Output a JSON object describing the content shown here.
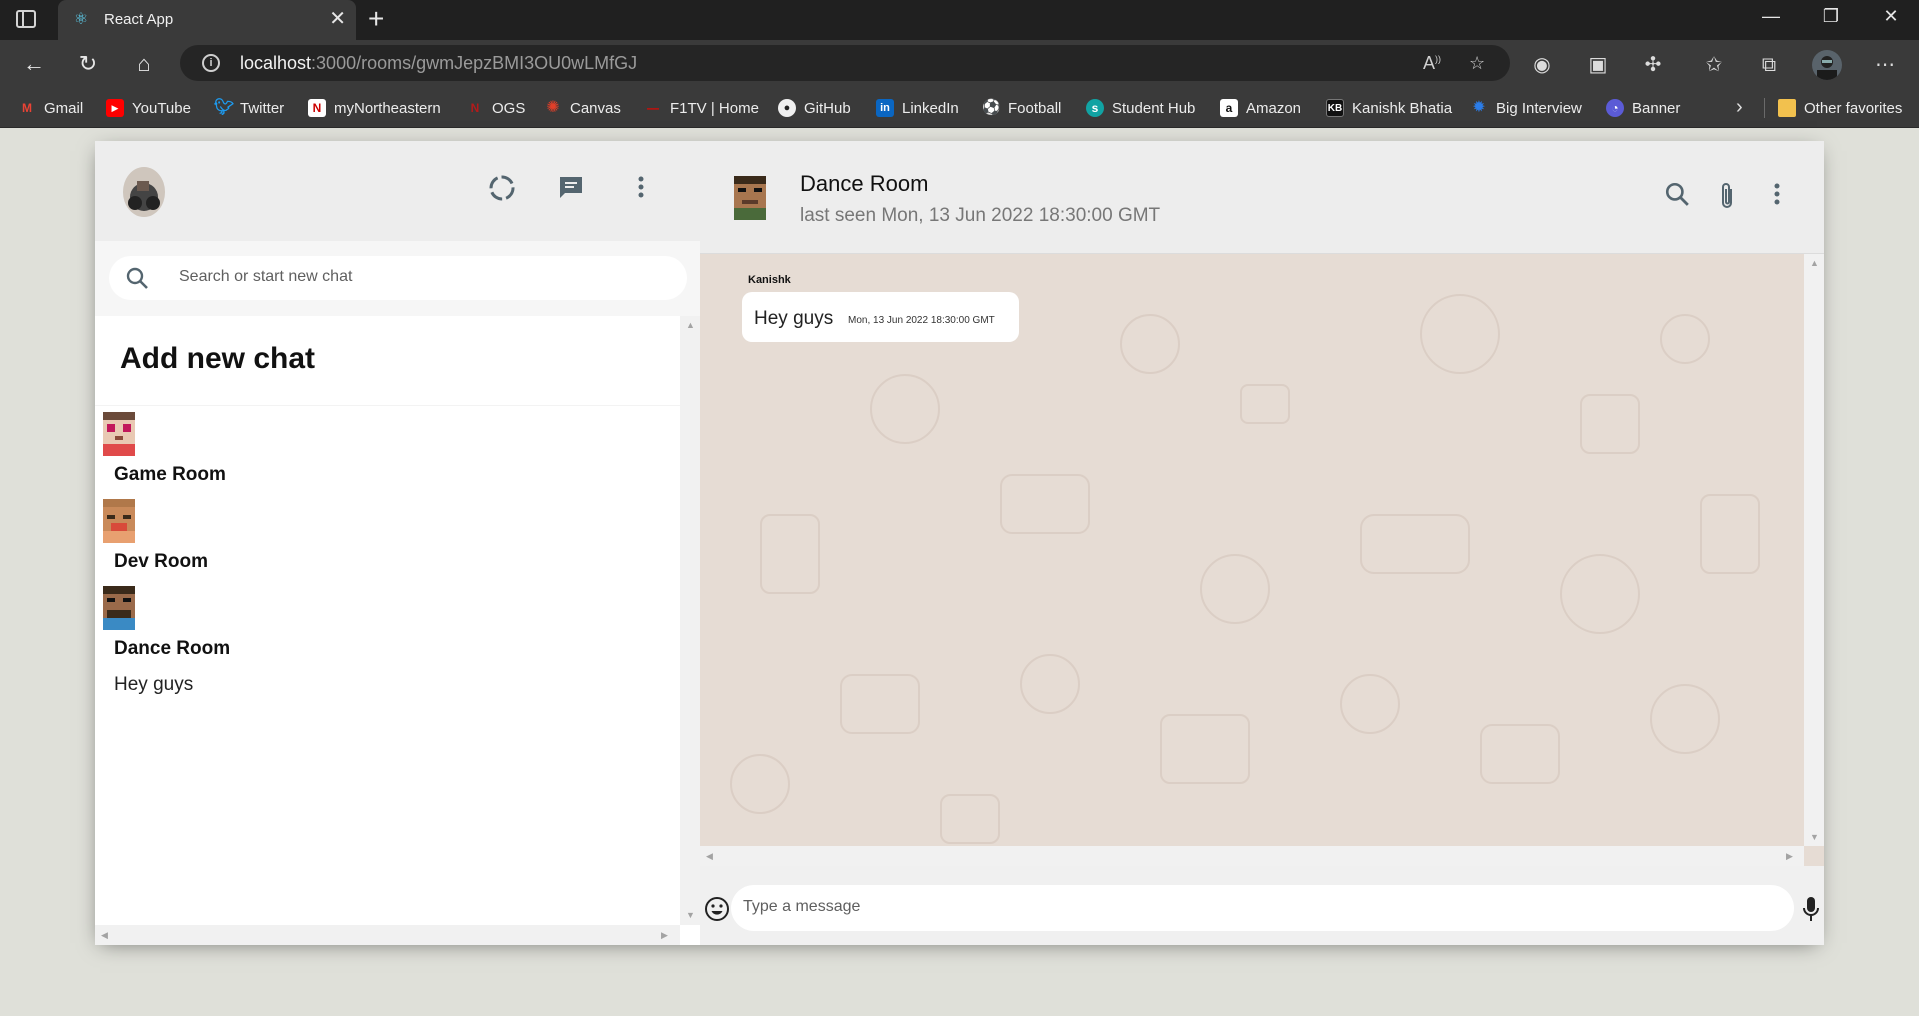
{
  "browser": {
    "tab_title": "React App",
    "url_host": "localhost",
    "url_path": ":3000/rooms/gwmJepzBMI3OU0wLMfGJ",
    "bookmarks": [
      {
        "label": "Gmail",
        "color": "#ea4335",
        "glyph": "M"
      },
      {
        "label": "YouTube",
        "color": "#ff0000",
        "glyph": "▶"
      },
      {
        "label": "Twitter",
        "color": "#1d9bf0",
        "glyph": "t"
      },
      {
        "label": "myNortheastern",
        "color": "#cc0000",
        "glyph": "N"
      },
      {
        "label": "OGS",
        "color": "#b31b1b",
        "glyph": "N"
      },
      {
        "label": "Canvas",
        "color": "#e13f29",
        "glyph": "✺"
      },
      {
        "label": "F1TV | Home",
        "color": "#e10600",
        "glyph": "—"
      },
      {
        "label": "GitHub",
        "color": "#f0f0f0",
        "glyph": "●"
      },
      {
        "label": "LinkedIn",
        "color": "#0a66c2",
        "glyph": "in"
      },
      {
        "label": "Football",
        "color": "#6a8a3a",
        "glyph": "⚽"
      },
      {
        "label": "Student Hub",
        "color": "#11a3a3",
        "glyph": "s"
      },
      {
        "label": "Amazon",
        "color": "#ffffff",
        "glyph": "a"
      },
      {
        "label": "Kanishk Bhatia",
        "color": "#111111",
        "glyph": "K"
      },
      {
        "label": "Big Interview",
        "color": "#2b7de9",
        "glyph": "✹"
      },
      {
        "label": "Banner",
        "color": "#5b5bd6",
        "glyph": "◔"
      }
    ],
    "other_favorites": "Other favorites"
  },
  "sidebar": {
    "search_placeholder": "Search or start new chat",
    "add_new_chat": "Add new chat",
    "chats": [
      {
        "name": "Game Room",
        "last_message": ""
      },
      {
        "name": "Dev Room",
        "last_message": ""
      },
      {
        "name": "Dance Room",
        "last_message": "Hey guys"
      }
    ]
  },
  "chat": {
    "room_name": "Dance Room",
    "last_seen": "last seen Mon, 13 Jun 2022 18:30:00 GMT",
    "messages": [
      {
        "sender": "Kanishk",
        "text": "Hey guys",
        "timestamp": "Mon, 13 Jun 2022 18:30:00 GMT"
      }
    ],
    "input_placeholder": "Type a message"
  },
  "icons": {
    "sidebar_header": [
      "status-icon",
      "new-chat-icon",
      "more-vert-icon"
    ],
    "chat_header": [
      "search-icon",
      "attach-icon",
      "more-vert-icon"
    ],
    "footer": [
      "emoji-icon",
      "mic-icon"
    ]
  }
}
